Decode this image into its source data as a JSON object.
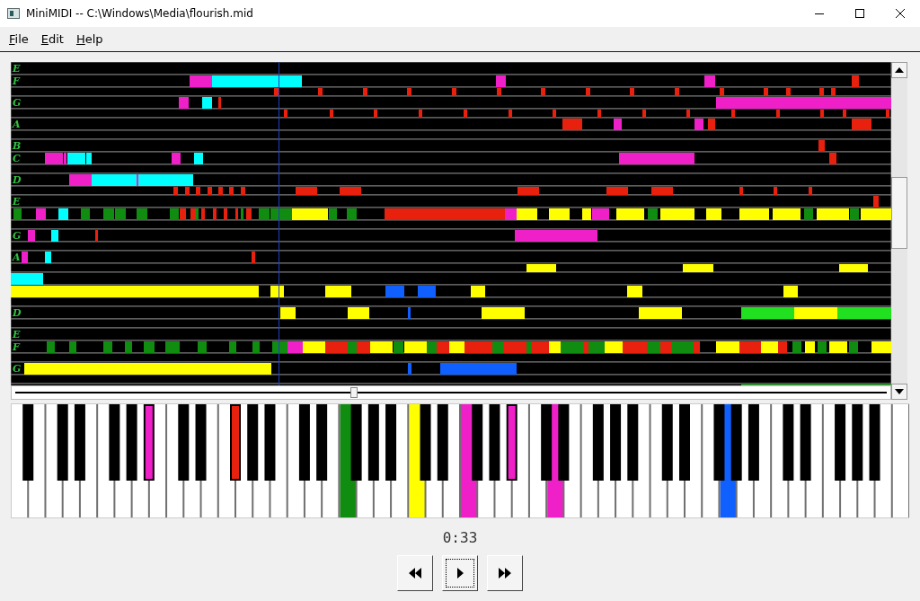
{
  "window": {
    "title": "MiniMIDI -- C:\\Windows\\Media\\flourish.mid"
  },
  "menu": [
    {
      "label": "File"
    },
    {
      "label": "Edit"
    },
    {
      "label": "Help"
    }
  ],
  "lanes": [
    {
      "label": "E",
      "sharp": false
    },
    {
      "label": "F",
      "sharp": false
    },
    {
      "sharp": true
    },
    {
      "label": "G",
      "sharp": false
    },
    {
      "sharp": true
    },
    {
      "label": "A",
      "sharp": false
    },
    {
      "sharp": true
    },
    {
      "label": "B",
      "sharp": false
    },
    {
      "label": "C",
      "sharp": false
    },
    {
      "sharp": true
    },
    {
      "label": "D",
      "sharp": false
    },
    {
      "sharp": true
    },
    {
      "label": "E",
      "sharp": false
    },
    {
      "sharp": false
    },
    {
      "sharp": true
    },
    {
      "label": "G",
      "sharp": false
    },
    {
      "sharp": true
    },
    {
      "label": "A",
      "sharp": false
    },
    {
      "sharp": true
    },
    {
      "sharp": false
    },
    {
      "sharp": false
    },
    {
      "sharp": true
    },
    {
      "label": "D",
      "sharp": false
    },
    {
      "sharp": true
    },
    {
      "label": "E",
      "sharp": false
    },
    {
      "label": "F",
      "sharp": false
    },
    {
      "sharp": true
    },
    {
      "label": "G",
      "sharp": false
    },
    {
      "sharp": true
    },
    {
      "sharp": false
    }
  ],
  "position_slider": {
    "level": 0.39
  },
  "keys": [
    {
      "pressed": false
    },
    {
      "pressed": false
    },
    {
      "pressed": false
    },
    {
      "pressed": false
    },
    {
      "pressed": false
    },
    {
      "pressed": false
    },
    {
      "pressed": false
    },
    {
      "pressed": false
    },
    {
      "pressed": false
    },
    {
      "pressed": false
    },
    {
      "pressed": false
    },
    {
      "pressed": false
    },
    {
      "pressed": false
    },
    {
      "pressed": true,
      "color": "#f020c8"
    },
    {
      "pressed": false
    },
    {
      "pressed": false
    },
    {
      "pressed": false
    },
    {
      "pressed": false
    },
    {
      "pressed": false
    },
    {
      "pressed": false
    },
    {
      "pressed": false
    },
    {
      "pressed": true,
      "color": "#e8200e"
    },
    {
      "pressed": false
    },
    {
      "pressed": false
    },
    {
      "pressed": false
    },
    {
      "pressed": false
    },
    {
      "pressed": false
    },
    {
      "pressed": false
    },
    {
      "pressed": false
    },
    {
      "pressed": false
    },
    {
      "pressed": false
    },
    {
      "pressed": false
    },
    {
      "pressed": true,
      "color": "#108c10"
    },
    {
      "pressed": false
    },
    {
      "pressed": false
    },
    {
      "pressed": false
    },
    {
      "pressed": false
    },
    {
      "pressed": false
    },
    {
      "pressed": false
    },
    {
      "pressed": true,
      "color": "#ffff00"
    },
    {
      "pressed": false
    },
    {
      "pressed": false
    },
    {
      "pressed": false
    },
    {
      "pressed": false
    },
    {
      "pressed": true,
      "color": "#f020c8"
    },
    {
      "pressed": false
    },
    {
      "pressed": false
    },
    {
      "pressed": false
    },
    {
      "pressed": false
    },
    {
      "pressed": true,
      "color": "#f020c8"
    },
    {
      "pressed": false
    },
    {
      "pressed": false
    },
    {
      "pressed": false
    },
    {
      "pressed": true,
      "color": "#f020c8"
    },
    {
      "pressed": false
    },
    {
      "pressed": false
    },
    {
      "pressed": false
    },
    {
      "pressed": false
    },
    {
      "pressed": false
    },
    {
      "pressed": false
    },
    {
      "pressed": false
    },
    {
      "pressed": false
    },
    {
      "pressed": false
    },
    {
      "pressed": false
    },
    {
      "pressed": false
    },
    {
      "pressed": false
    },
    {
      "pressed": false
    },
    {
      "pressed": false
    },
    {
      "pressed": false
    },
    {
      "pressed": false
    },
    {
      "pressed": true,
      "color": "#1060ff"
    },
    {
      "pressed": false
    },
    {
      "pressed": false
    },
    {
      "pressed": false
    },
    {
      "pressed": false
    },
    {
      "pressed": false
    },
    {
      "pressed": false
    },
    {
      "pressed": false
    },
    {
      "pressed": false
    },
    {
      "pressed": false
    },
    {
      "pressed": false
    },
    {
      "pressed": false
    },
    {
      "pressed": false
    },
    {
      "pressed": false
    },
    {
      "pressed": false
    },
    {
      "pressed": false
    },
    {
      "pressed": false
    },
    {
      "pressed": false
    }
  ],
  "time": "0:33"
}
